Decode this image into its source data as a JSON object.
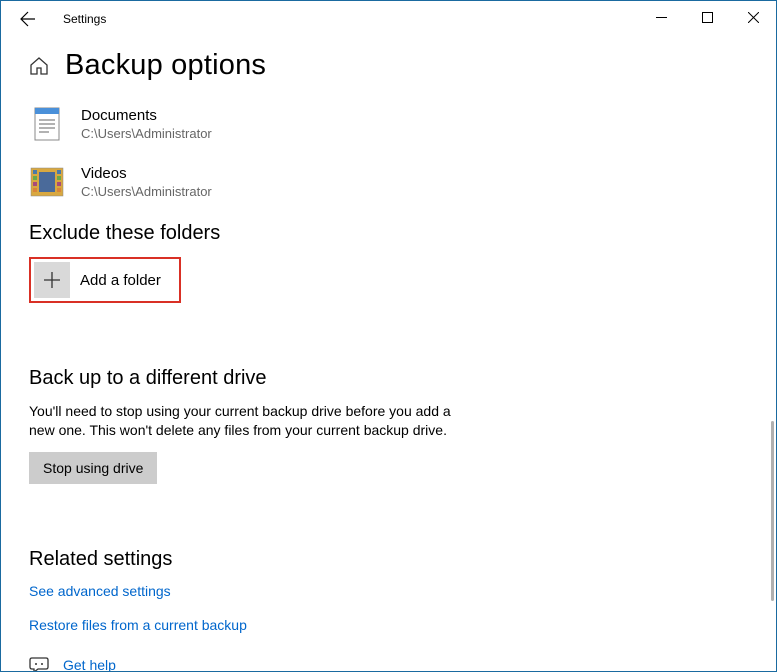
{
  "titlebar": {
    "app_name": "Settings"
  },
  "header": {
    "page_title": "Backup options"
  },
  "folders": [
    {
      "name": "Documents",
      "path": "C:\\Users\\Administrator",
      "icon": "document"
    },
    {
      "name": "Videos",
      "path": "C:\\Users\\Administrator",
      "icon": "video"
    }
  ],
  "exclude_section": {
    "heading": "Exclude these folders",
    "add_label": "Add a folder"
  },
  "different_drive": {
    "heading": "Back up to a different drive",
    "description": "You'll need to stop using your current backup drive before you add a new one. This won't delete any files from your current backup drive.",
    "button": "Stop using drive"
  },
  "related": {
    "heading": "Related settings",
    "advanced_link": "See advanced settings",
    "restore_link": "Restore files from a current backup"
  },
  "help": {
    "label": "Get help"
  }
}
